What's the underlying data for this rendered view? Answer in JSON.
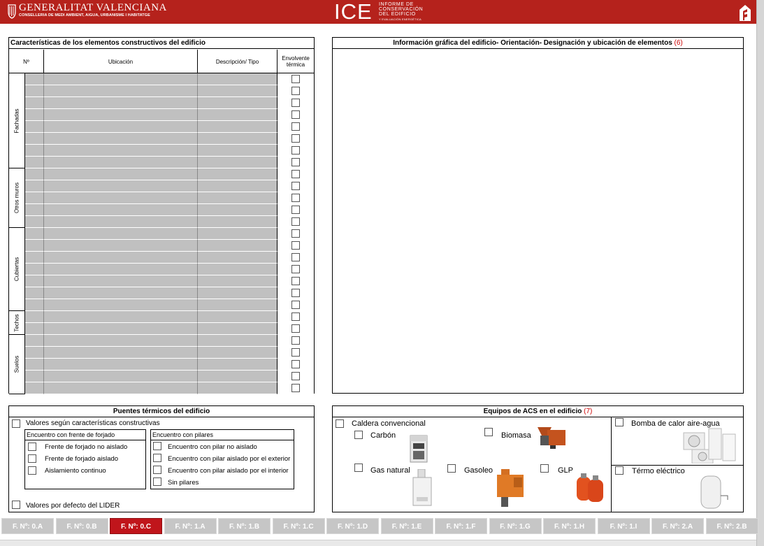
{
  "header": {
    "org_title": "GENERALITAT VALENCIANA",
    "org_subtitle": "CONSELLERIA DE MEDI AMBIENT, AIGUA, URBANISME I HABITATGE",
    "logo_text": "ICE",
    "logo_desc_1": "INFORME DE",
    "logo_desc_2": "CONSERVACIÓN",
    "logo_desc_3": "DEL EDIFICIO",
    "logo_desc_4": "Y EVALUACIÓN ENERGÉTICA",
    "brand_color": "#b5221c"
  },
  "constructive": {
    "title": "Características de los elementos constructivos del edificio",
    "col_num": "Nº",
    "col_location": "Ubicación",
    "col_desc": "Descripción/ Tipo",
    "col_envelope_1": "Envolvente",
    "col_envelope_2": "térmica",
    "groups": [
      {
        "label": "Fachadas",
        "rows": 8
      },
      {
        "label": "Otros muros",
        "rows": 5
      },
      {
        "label": "Cubiertas",
        "rows": 7
      },
      {
        "label": "Techos",
        "rows": 2
      },
      {
        "label": "Suelos",
        "rows": 5
      }
    ]
  },
  "graphic": {
    "title": "Información gráfica del edificio- Orientación- Designación y ubicación de elementos",
    "note": "(6)"
  },
  "bridges": {
    "title": "Puentes térmicos del edificio",
    "option_constructive": "Valores según características constructivas",
    "forjado_title": "Encuentro con frente de forjado",
    "forjado_items": [
      "Frente de forjado no aislado",
      "Frente de forjado aislado",
      "Aislamiento continuo"
    ],
    "pilares_title": "Encuentro con pilares",
    "pilares_items": [
      "Encuentro con pilar no aislado",
      "Encuentro con pilar aislado por el exterior",
      "Encuentro con pilar aislado por el interior",
      "Sin pilares"
    ],
    "option_default": "Valores por defecto del LIDER"
  },
  "acs": {
    "title": "Equipos de ACS en el edificio",
    "note": "(7)",
    "caldera": "Caldera convencional",
    "carbon": "Carbón",
    "biomasa": "Biomasa",
    "gas_natural": "Gas natural",
    "gasoleo": "Gasoleo",
    "glp": "GLP",
    "bomba": "Bomba de calor aire-agua",
    "termo": "Térmo eléctrico"
  },
  "tabs": [
    {
      "label": "F. Nº: 0.A",
      "active": false
    },
    {
      "label": "F. Nº: 0.B",
      "active": false
    },
    {
      "label": "F. Nº: 0.C",
      "active": true
    },
    {
      "label": "F. Nº: 1.A",
      "active": false
    },
    {
      "label": "F. Nº: 1.B",
      "active": false
    },
    {
      "label": "F. Nº: 1.C",
      "active": false
    },
    {
      "label": "F. Nº: 1.D",
      "active": false
    },
    {
      "label": "F. Nº: 1.E",
      "active": false
    },
    {
      "label": "F. Nº: 1.F",
      "active": false
    },
    {
      "label": "F. Nº: 1.G",
      "active": false
    },
    {
      "label": "F. Nº: 1.H",
      "active": false
    },
    {
      "label": "F. Nº: 1.I",
      "active": false
    },
    {
      "label": "F. Nº: 2.A",
      "active": false
    },
    {
      "label": "F. Nº: 2.B",
      "active": false
    }
  ],
  "colors": {
    "active_tab": "#c0151b",
    "inactive_tab": "#c6c6c6",
    "cell_gray": "#c0c0c0",
    "note_red": "#cc0000"
  }
}
